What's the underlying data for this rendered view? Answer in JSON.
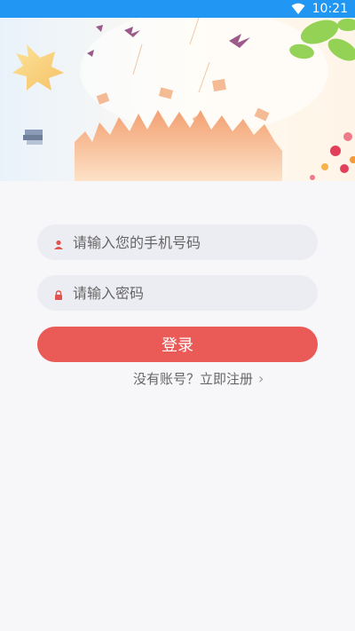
{
  "status_bar": {
    "time": "10:21",
    "wifi_icon": "wifi-icon"
  },
  "form": {
    "phone_placeholder": "请输入您的手机号码",
    "password_placeholder": "请输入密码",
    "login_label": "登录",
    "register_prompt": "没有账号？立即注册"
  },
  "colors": {
    "status_bar": "#2196f3",
    "accent": "#ea5a56",
    "field_bg": "#ececf3",
    "page_bg": "#f7f7f9"
  }
}
